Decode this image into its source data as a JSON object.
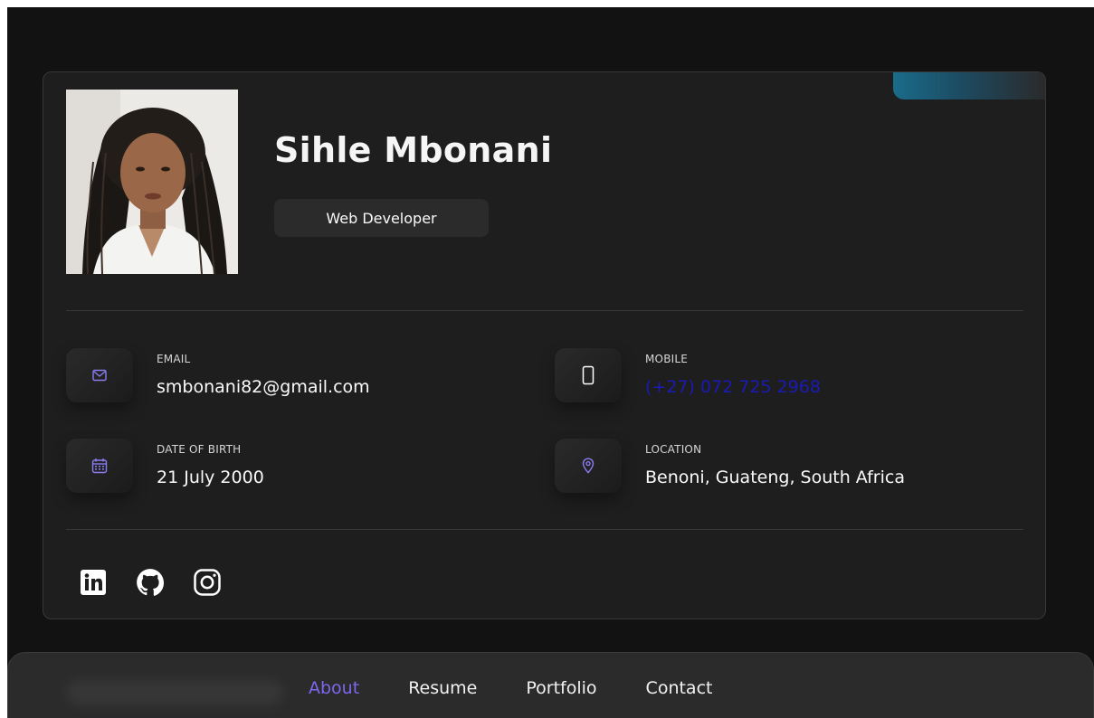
{
  "profile": {
    "name": "Sihle Mbonani",
    "title": "Web Developer"
  },
  "contacts": [
    {
      "label": "Email",
      "value": "smbonani82@gmail.com",
      "icon": "mail-icon"
    },
    {
      "label": "Mobile",
      "value": "(+27) 072 725 2968",
      "icon": "phone-icon"
    },
    {
      "label": "Date of Birth",
      "value": "21 July 2000",
      "icon": "calendar-icon"
    },
    {
      "label": "Location",
      "value": "Benoni, Guateng, South Africa",
      "icon": "location-pin-icon"
    }
  ],
  "social": [
    "linkedin-icon",
    "github-icon",
    "instagram-icon"
  ],
  "nav": {
    "items": [
      "About",
      "Resume",
      "Portfolio",
      "Contact"
    ],
    "active": "About"
  },
  "colors": {
    "background": "#121212",
    "card": "#1e1e1f",
    "accent": "#7b68ee",
    "phone_link": "#1a1ab4",
    "corner_accent": "#1a6c8a"
  }
}
